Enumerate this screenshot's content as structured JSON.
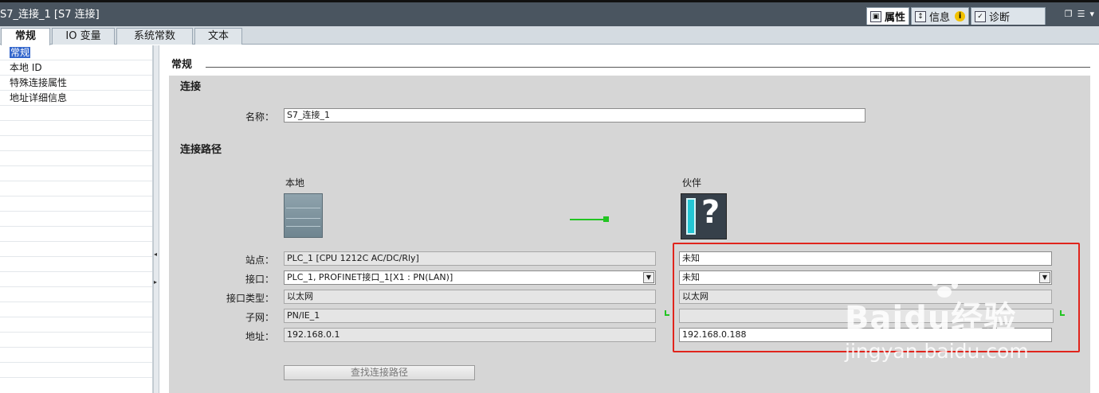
{
  "window": {
    "title": "S7_连接_1 [S7 连接]"
  },
  "inspector_tabs": [
    {
      "label": "属性",
      "icon": "properties-icon"
    },
    {
      "label": "信息",
      "icon": "info-icon",
      "badge": "i"
    },
    {
      "label": "诊断",
      "icon": "diagnostics-icon"
    }
  ],
  "tabs": [
    "常规",
    "IO 变量",
    "系统常数",
    "文本"
  ],
  "nav": {
    "items": [
      "常规",
      "本地 ID",
      "特殊连接属性",
      "地址详细信息"
    ]
  },
  "section": {
    "title": "常规"
  },
  "connection": {
    "heading": "连接",
    "name_label": "名称：",
    "name_value": "S7_连接_1"
  },
  "path": {
    "heading": "连接路径",
    "local_title": "本地",
    "partner_title": "伙伴",
    "labels": {
      "station": "站点：",
      "interface": "接口：",
      "interface_type": "接口类型：",
      "subnet": "子网：",
      "address": "地址："
    },
    "local": {
      "station": "PLC_1 [CPU 1212C AC/DC/Rly]",
      "interface": "PLC_1, PROFINET接口_1[X1 : PN(LAN)]",
      "interface_type": "以太网",
      "subnet": "PN/IE_1",
      "address": "192.168.0.1"
    },
    "partner": {
      "station": "未知",
      "interface": "未知",
      "interface_type": "以太网",
      "subnet": "",
      "address": "192.168.0.188"
    },
    "find_button": "查找连接路径"
  },
  "watermark": {
    "brand": "Baidu经验",
    "url": "jingyan.baidu.com"
  },
  "colors": {
    "titlebar": "#4a5560",
    "panel": "#d6d6d6",
    "highlight": "#e0241c",
    "link_green": "#22c422"
  }
}
